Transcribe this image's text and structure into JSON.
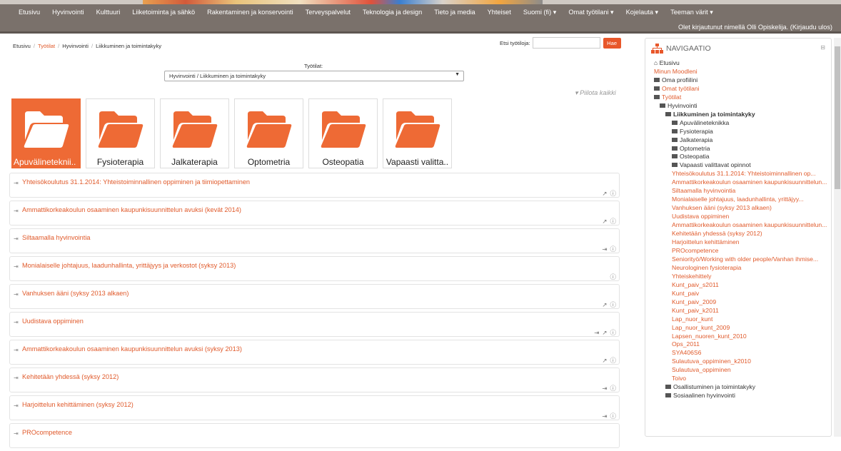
{
  "menu": [
    "Etusivu",
    "Hyvinvointi",
    "Kulttuuri",
    "Liiketoiminta ja sähkö",
    "Rakentaminen ja konservointi",
    "Terveyspalvelut",
    "Teknologia ja design",
    "Tieto ja media",
    "Yhteiset",
    "Suomi (fi) ▾",
    "Omat työtilani ▾",
    "Kojelauta ▾",
    "Teeman värit ▾"
  ],
  "logged_in": "Olet kirjautunut nimellä Olli Opiskelija. (Kirjaudu ulos)",
  "breadcrumb": [
    "Etusivu",
    "Työtilat",
    "Hyvinvointi",
    "Liikkuminen ja toimintakyky"
  ],
  "search": {
    "label": "Etsi työtiloja:",
    "value": "",
    "button": "Hae"
  },
  "selector": {
    "label": "Työtilat:",
    "value": "Hyvinvointi / Liikkuminen ja toimintakyky"
  },
  "hide_all": "▾ Piilota kaikki",
  "tiles": [
    "Apuvälineteknii..",
    "Fysioterapia",
    "Jalkaterapia",
    "Optometria",
    "Osteopatia",
    "Vapaasti valitta.."
  ],
  "courses": [
    {
      "title": "Yhteisökoulutus 31.1.2014: Yhteistoiminnallinen oppiminen ja tiimiopettaminen",
      "actions": [
        "↗",
        "ⓘ"
      ]
    },
    {
      "title": "Ammattikorkeakoulun osaaminen kaupunkisuunnittelun avuksi (kevät 2014)",
      "actions": [
        "↗",
        "ⓘ"
      ]
    },
    {
      "title": "Siltaamalla hyvinvointia",
      "actions": [
        "⇥",
        "ⓘ"
      ]
    },
    {
      "title": "Monialaiselle johtajuus, laadunhallinta, yrittäjyys ja verkostot (syksy 2013)",
      "actions": [
        "ⓘ"
      ]
    },
    {
      "title": "Vanhuksen ääni (syksy 2013 alkaen)",
      "actions": [
        "↗",
        "ⓘ"
      ]
    },
    {
      "title": "Uudistava oppiminen",
      "actions": [
        "⇥",
        "↗",
        "ⓘ"
      ]
    },
    {
      "title": "Ammattikorkeakoulun osaaminen kaupunkisuunnittelun avuksi (syksy 2013)",
      "actions": [
        "↗",
        "ⓘ"
      ]
    },
    {
      "title": "Kehitetään yhdessä (syksy 2012)",
      "actions": [
        "⇥",
        "ⓘ"
      ]
    },
    {
      "title": "Harjoittelun kehittäminen (syksy 2012)",
      "actions": [
        "⇥",
        "ⓘ"
      ]
    },
    {
      "title": "PROcompetence",
      "actions": []
    }
  ],
  "nav": {
    "title": "NAVIGAATIO",
    "home": "Etusivu",
    "my_moodle": "Minun Moodleni",
    "profile": "Oma profiilini",
    "my_spaces": "Omat työtilani",
    "spaces": "Työtilat",
    "wellbeing": "Hyvinvointi",
    "current": "Liikkuminen ja toimintakyky",
    "folders": [
      "Apuvälineteknikka",
      "Fysioterapia",
      "Jalkaterapia",
      "Optometria",
      "Osteopatia",
      "Vapaasti valittavat opinnot"
    ],
    "links": [
      "Yhteisökoulutus 31.1.2014: Yhteistoiminnallinen op...",
      "Ammattikorkeakoulun osaaminen kaupunkisuunnittelun...",
      "Siltaamalla hyvinvointia",
      "Monialaiselle johtajuus, laadunhallinta, yrittäjyy...",
      "Vanhuksen ääni (syksy 2013 alkaen)",
      "Uudistava oppiminen",
      "Ammattikorkeakoulun osaaminen kaupunkisuunnittelun...",
      "Kehitetään yhdessä (syksy 2012)",
      "Harjoittelun kehittäminen",
      "PROcompetence",
      "Seniorityö/Working with older people/Vanhan ihmise...",
      "Neurologinen fysioterapia",
      "Yhteiskehittely",
      "Kunt_paiv_s2011",
      "Kunt_paiv",
      "Kunt_paiv_2009",
      "Kunt_paiv_k2011",
      "Lap_nuor_kunt",
      "Lap_nuor_kunt_2009",
      "Lapsen_nuoren_kunt_2010",
      "Ops_2011",
      "SYA406S6",
      "Sulautuva_oppiminen_k2010",
      "Sulautuva_oppiminen",
      "Toivo"
    ],
    "tail": [
      "Osallistuminen ja toimintakyky",
      "Sosiaalinen hyvinvointi"
    ]
  }
}
